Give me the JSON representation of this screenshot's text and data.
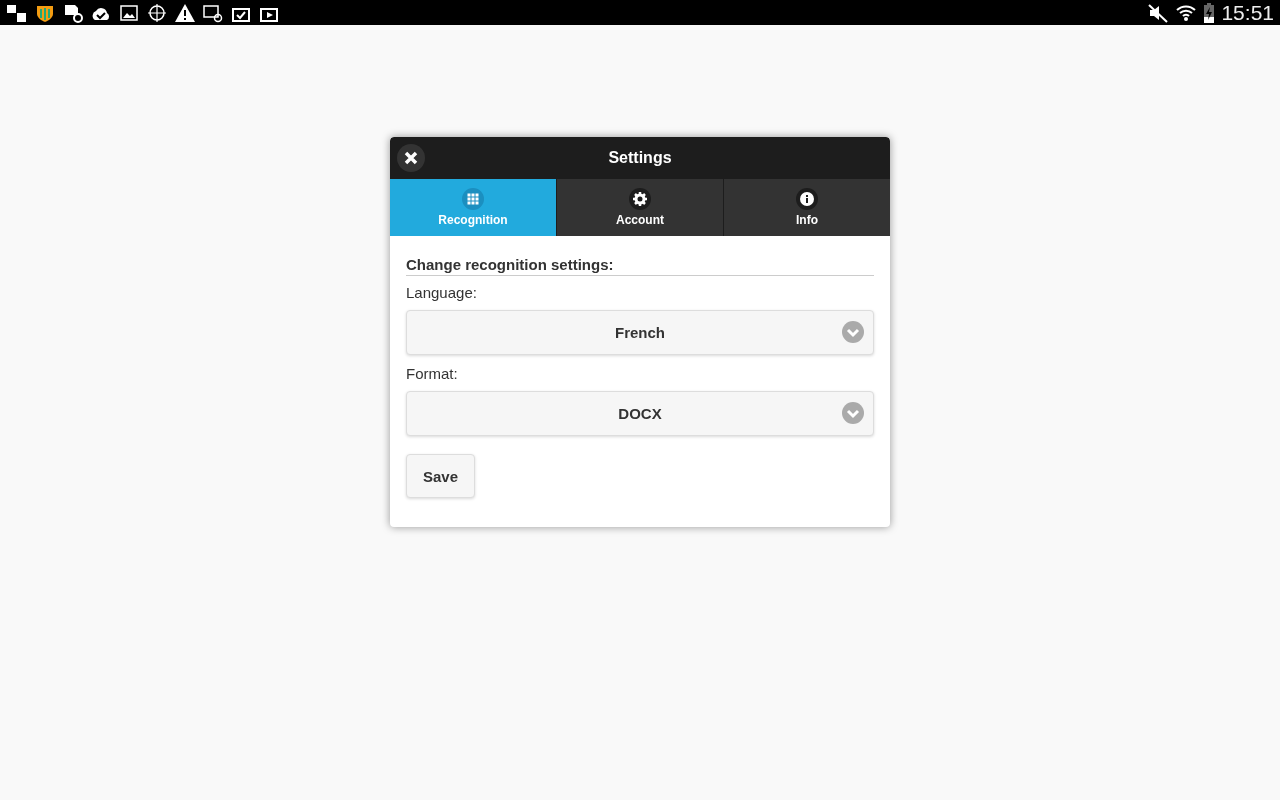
{
  "status_bar": {
    "time": "15:51"
  },
  "dialog": {
    "title": "Settings",
    "tabs": [
      {
        "label": "Recognition",
        "kind": "grid",
        "selected": true
      },
      {
        "label": "Account",
        "kind": "gear",
        "selected": false
      },
      {
        "label": "Info",
        "kind": "info",
        "selected": false
      }
    ],
    "heading": "Change recognition settings:",
    "fields": [
      {
        "label": "Language:",
        "value": "French"
      },
      {
        "label": "Format:",
        "value": "DOCX"
      }
    ],
    "save_button": "Save"
  }
}
